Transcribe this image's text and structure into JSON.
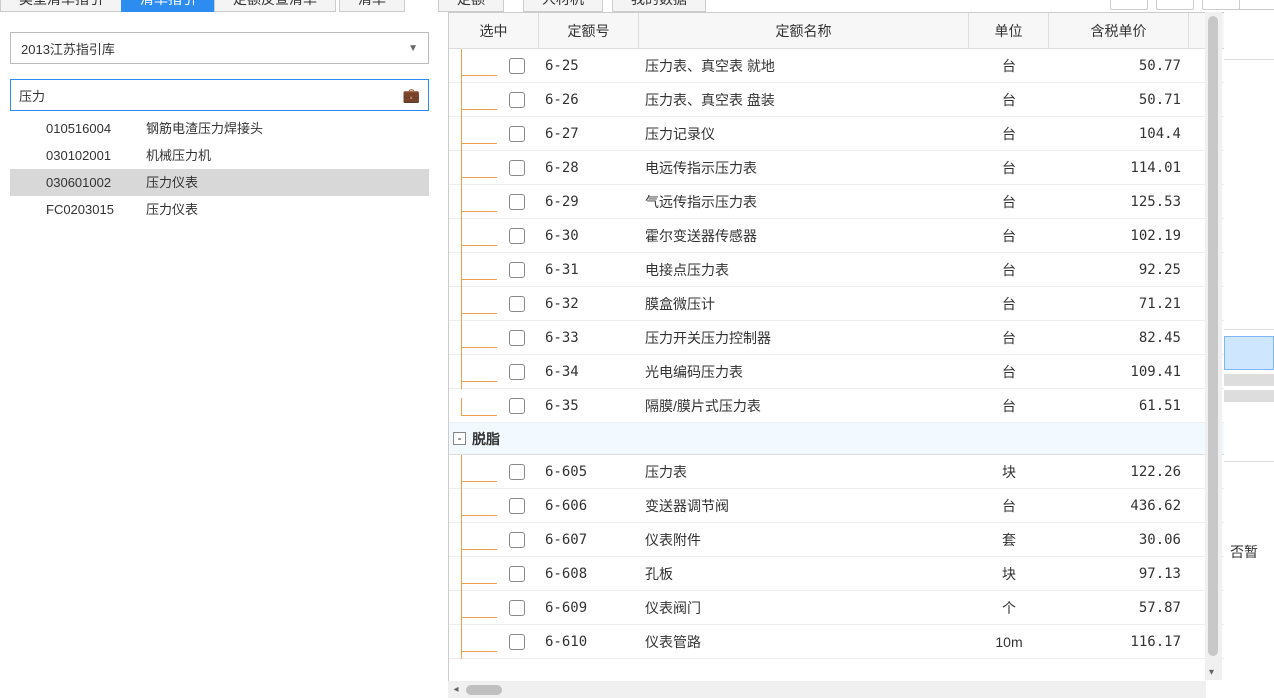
{
  "tabs": {
    "t0": "类型清单指引",
    "t1": "清单指引",
    "t2": "定额反查清单",
    "t3": "清单",
    "t4": "定额",
    "t5": "人材机",
    "t6": "我的数据"
  },
  "dropdown": {
    "value": "2013江苏指引库"
  },
  "search": {
    "value": "压力"
  },
  "tree": {
    "items": [
      {
        "code": "010516004",
        "name": "钢筋电渣压力焊接头"
      },
      {
        "code": "030102001",
        "name": "机械压力机"
      },
      {
        "code": "030601002",
        "name": "压力仪表"
      },
      {
        "code": "FC0203015",
        "name": "压力仪表"
      }
    ]
  },
  "table": {
    "headers": {
      "select": "选中",
      "code": "定额号",
      "name": "定额名称",
      "unit": "单位",
      "price": "含税单价"
    },
    "rows1": [
      {
        "code": "6-25",
        "name": "压力表、真空表 就地",
        "unit": "台",
        "price": "50.77"
      },
      {
        "code": "6-26",
        "name": "压力表、真空表 盘装",
        "unit": "台",
        "price": "50.71"
      },
      {
        "code": "6-27",
        "name": "压力记录仪",
        "unit": "台",
        "price": "104.4"
      },
      {
        "code": "6-28",
        "name": "电远传指示压力表",
        "unit": "台",
        "price": "114.01"
      },
      {
        "code": "6-29",
        "name": "气远传指示压力表",
        "unit": "台",
        "price": "125.53"
      },
      {
        "code": "6-30",
        "name": "霍尔变送器传感器",
        "unit": "台",
        "price": "102.19"
      },
      {
        "code": "6-31",
        "name": "电接点压力表",
        "unit": "台",
        "price": "92.25"
      },
      {
        "code": "6-32",
        "name": "膜盒微压计",
        "unit": "台",
        "price": "71.21"
      },
      {
        "code": "6-33",
        "name": "压力开关压力控制器",
        "unit": "台",
        "price": "82.45"
      },
      {
        "code": "6-34",
        "name": "光电编码压力表",
        "unit": "台",
        "price": "109.41"
      },
      {
        "code": "6-35",
        "name": "隔膜/膜片式压力表",
        "unit": "台",
        "price": "61.51"
      }
    ],
    "group": "脱脂",
    "rows2": [
      {
        "code": "6-605",
        "name": "压力表",
        "unit": "块",
        "price": "122.26"
      },
      {
        "code": "6-606",
        "name": "变送器调节阀",
        "unit": "台",
        "price": "436.62"
      },
      {
        "code": "6-607",
        "name": "仪表附件",
        "unit": "套",
        "price": "30.06"
      },
      {
        "code": "6-608",
        "name": "孔板",
        "unit": "块",
        "price": "97.13"
      },
      {
        "code": "6-609",
        "name": "仪表阀门",
        "unit": "个",
        "price": "57.87"
      },
      {
        "code": "6-610",
        "name": "仪表管路",
        "unit": "10m",
        "price": "116.17"
      }
    ]
  },
  "sliver": {
    "text": "否暂"
  }
}
